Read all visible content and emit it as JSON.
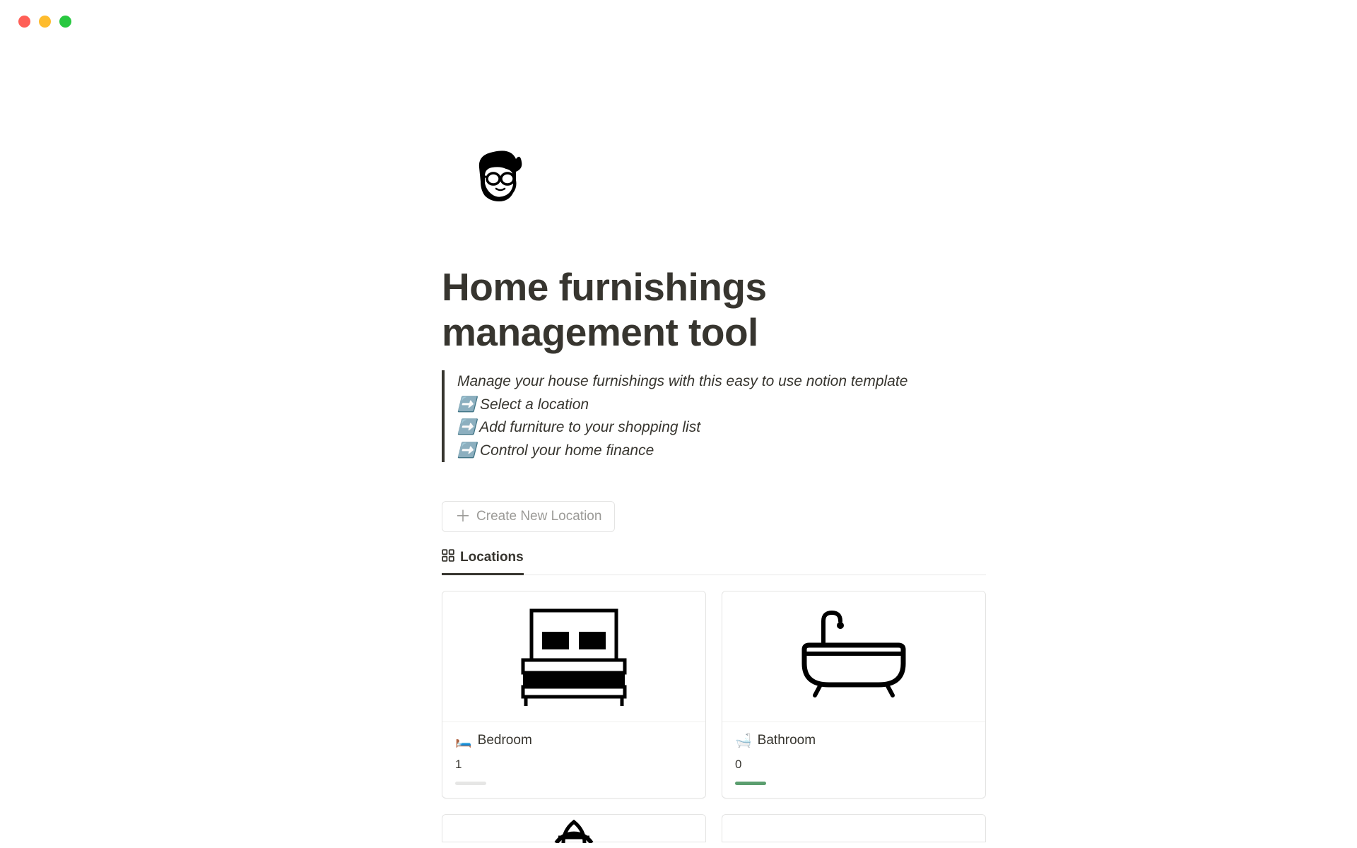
{
  "window": {
    "traffic_lights": [
      "red",
      "yellow",
      "green"
    ]
  },
  "page": {
    "title": "Home furnishings management tool",
    "icon_name": "person-glasses-icon"
  },
  "quote": {
    "intro": "Manage your house furnishings with this easy to use notion template",
    "lines": [
      "➡️ Select a location",
      "➡️ Add furniture to your shopping list",
      "➡️ Control your home finance"
    ]
  },
  "actions": {
    "create_location_label": "Create New Location"
  },
  "tabs": {
    "locations_label": "Locations"
  },
  "cards": [
    {
      "emoji": "🛏️",
      "title": "Bedroom",
      "count": "1",
      "progress_color": "gray",
      "icon": "bed"
    },
    {
      "emoji": "🛁",
      "title": "Bathroom",
      "count": "0",
      "progress_color": "green",
      "icon": "bathtub"
    }
  ]
}
